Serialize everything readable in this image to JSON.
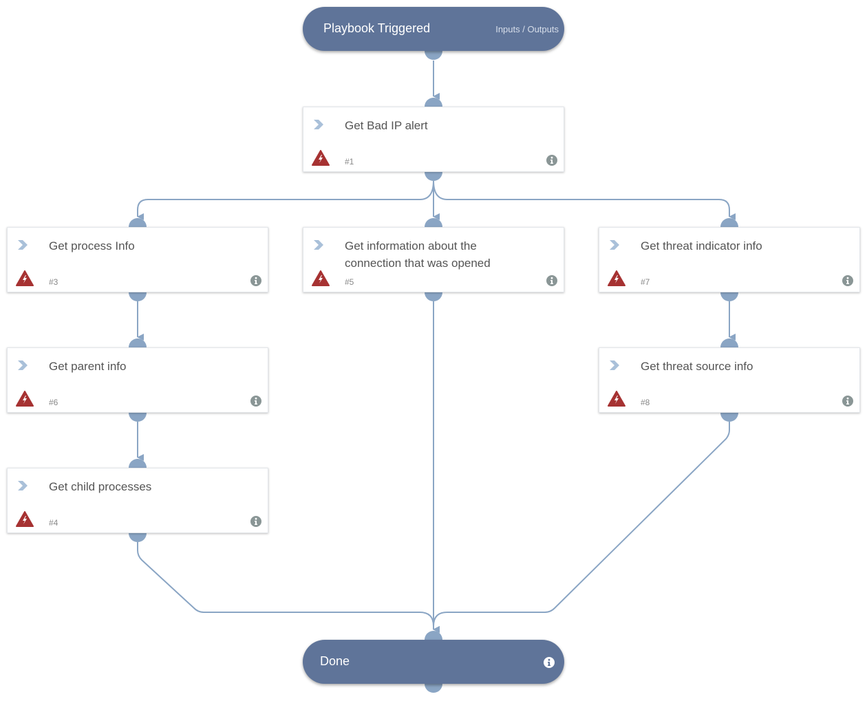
{
  "start": {
    "title": "Playbook Triggered",
    "io_label": "Inputs / Outputs"
  },
  "end": {
    "title": "Done"
  },
  "tasks": [
    {
      "id": "1",
      "name": "Get Bad IP alert",
      "number": "#1"
    },
    {
      "id": "3",
      "name": "Get process Info",
      "number": "#3"
    },
    {
      "id": "5",
      "name": "Get information about the connection that was opened",
      "number": "#5"
    },
    {
      "id": "7",
      "name": "Get threat indicator info",
      "number": "#7"
    },
    {
      "id": "6",
      "name": "Get parent info",
      "number": "#6"
    },
    {
      "id": "8",
      "name": "Get threat source info",
      "number": "#8"
    },
    {
      "id": "4",
      "name": "Get child processes",
      "number": "#4"
    }
  ],
  "icons": {
    "task_type": "chevron-right-icon",
    "alert": "warning-bolt-icon",
    "info": "info-icon"
  },
  "colors": {
    "pill": "#5f7499",
    "connector": "#8aa5c4",
    "alert": "#a63232",
    "chevron": "#a9c0d9",
    "info": "#8a9696"
  }
}
